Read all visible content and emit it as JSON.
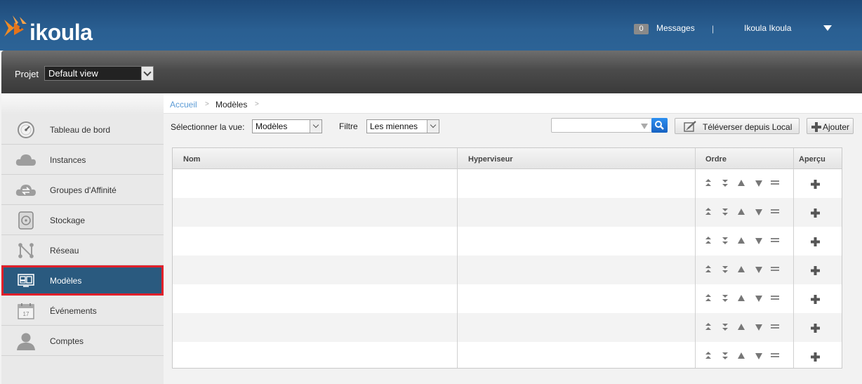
{
  "header": {
    "logo_text": "ikoula",
    "messages_count": "0",
    "messages_label": "Messages",
    "separator": "|",
    "user_name": "Ikoula Ikoula"
  },
  "project": {
    "label": "Projet",
    "selected": "Default view"
  },
  "sidebar": {
    "items": [
      {
        "label": "Tableau de bord",
        "icon": "dashboard-gauge-icon"
      },
      {
        "label": "Instances",
        "icon": "cloud-icon"
      },
      {
        "label": "Groupes d'Affinité",
        "icon": "cloud-sync-icon"
      },
      {
        "label": "Stockage",
        "icon": "disk-icon"
      },
      {
        "label": "Réseau",
        "icon": "network-icon"
      },
      {
        "label": "Modèles",
        "icon": "templates-icon",
        "active": true
      },
      {
        "label": "Événements",
        "icon": "calendar-icon",
        "calendar_day": "17"
      },
      {
        "label": "Comptes",
        "icon": "user-icon"
      }
    ]
  },
  "breadcrumb": {
    "home": "Accueil",
    "sep": ">",
    "current": "Modèles"
  },
  "toolbar": {
    "view_label": "Sélectionner la vue:",
    "view_selected": "Modèles",
    "filter_label": "Filtre",
    "filter_selected": "Les miennes",
    "search_value": "",
    "upload_label": "Téléverser depuis Local",
    "add_label": "Ajouter"
  },
  "table": {
    "columns": [
      "Nom",
      "Hyperviseur",
      "Ordre",
      "Aperçu"
    ],
    "rows": [
      {
        "nom": "",
        "hyperviseur": ""
      },
      {
        "nom": "",
        "hyperviseur": ""
      },
      {
        "nom": "",
        "hyperviseur": ""
      },
      {
        "nom": "",
        "hyperviseur": ""
      },
      {
        "nom": "",
        "hyperviseur": ""
      },
      {
        "nom": "",
        "hyperviseur": ""
      },
      {
        "nom": "",
        "hyperviseur": ""
      }
    ]
  },
  "colors": {
    "header_blue": "#2a5f92",
    "active_item": "#2a5a7f",
    "active_outline": "#e0202a",
    "logo_orange": "#f08a24",
    "link_blue": "#5b9bd5",
    "search_button": "#1f7de0"
  }
}
